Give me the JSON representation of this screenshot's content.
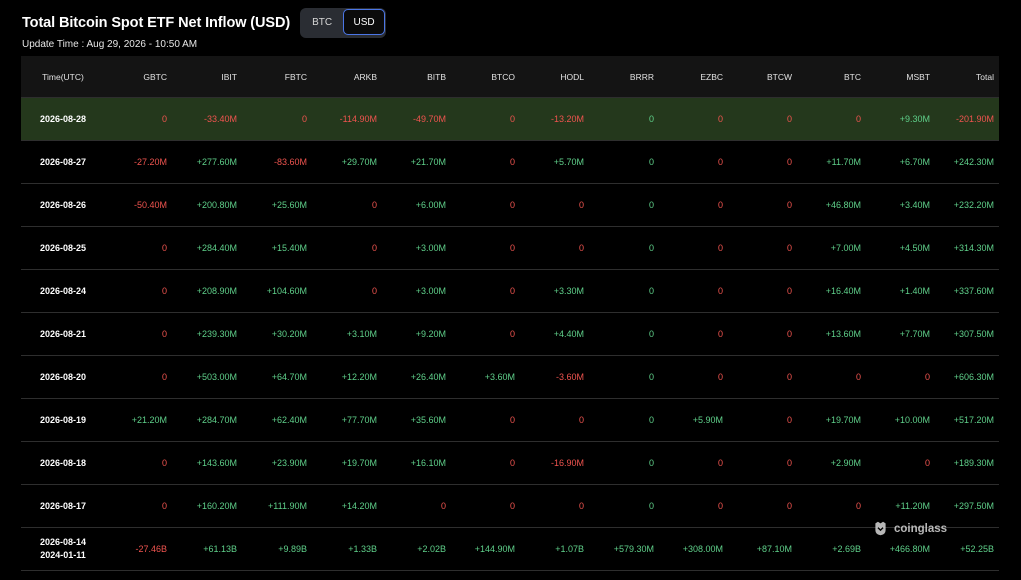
{
  "header": {
    "title": "Total Bitcoin Spot ETF Net Inflow (USD)",
    "toggle": {
      "options": [
        "BTC",
        "USD"
      ],
      "selected": "USD"
    },
    "update_time": "Update Time : Aug 29, 2026 - 10:50 AM"
  },
  "table": {
    "columns": [
      "Time(UTC)",
      "GBTC",
      "IBIT",
      "FBTC",
      "ARKB",
      "BITB",
      "BTCO",
      "HODL",
      "BRRR",
      "EZBC",
      "BTCW",
      "BTC",
      "MSBT",
      "Total"
    ],
    "rows": [
      {
        "time": [
          "2026-08-28"
        ],
        "highlight": true,
        "cells": [
          {
            "v": "0",
            "s": "neg"
          },
          {
            "v": "-33.40M",
            "s": "neg"
          },
          {
            "v": "0",
            "s": "neg"
          },
          {
            "v": "-114.90M",
            "s": "neg"
          },
          {
            "v": "-49.70M",
            "s": "neg"
          },
          {
            "v": "0",
            "s": "neg"
          },
          {
            "v": "-13.20M",
            "s": "neg"
          },
          {
            "v": "0",
            "s": "pos"
          },
          {
            "v": "0",
            "s": "neg"
          },
          {
            "v": "0",
            "s": "neg"
          },
          {
            "v": "0",
            "s": "neg"
          },
          {
            "v": "+9.30M",
            "s": "pos"
          },
          {
            "v": "-201.90M",
            "s": "neg"
          }
        ]
      },
      {
        "time": [
          "2026-08-27"
        ],
        "cells": [
          {
            "v": "-27.20M",
            "s": "neg"
          },
          {
            "v": "+277.60M",
            "s": "pos"
          },
          {
            "v": "-83.60M",
            "s": "neg"
          },
          {
            "v": "+29.70M",
            "s": "pos"
          },
          {
            "v": "+21.70M",
            "s": "pos"
          },
          {
            "v": "0",
            "s": "neg"
          },
          {
            "v": "+5.70M",
            "s": "pos"
          },
          {
            "v": "0",
            "s": "pos"
          },
          {
            "v": "0",
            "s": "neg"
          },
          {
            "v": "0",
            "s": "neg"
          },
          {
            "v": "+11.70M",
            "s": "pos"
          },
          {
            "v": "+6.70M",
            "s": "pos"
          },
          {
            "v": "+242.30M",
            "s": "pos"
          }
        ]
      },
      {
        "time": [
          "2026-08-26"
        ],
        "cells": [
          {
            "v": "-50.40M",
            "s": "neg"
          },
          {
            "v": "+200.80M",
            "s": "pos"
          },
          {
            "v": "+25.60M",
            "s": "pos"
          },
          {
            "v": "0",
            "s": "neg"
          },
          {
            "v": "+6.00M",
            "s": "pos"
          },
          {
            "v": "0",
            "s": "neg"
          },
          {
            "v": "0",
            "s": "neg"
          },
          {
            "v": "0",
            "s": "pos"
          },
          {
            "v": "0",
            "s": "neg"
          },
          {
            "v": "0",
            "s": "neg"
          },
          {
            "v": "+46.80M",
            "s": "pos"
          },
          {
            "v": "+3.40M",
            "s": "pos"
          },
          {
            "v": "+232.20M",
            "s": "pos"
          }
        ]
      },
      {
        "time": [
          "2026-08-25"
        ],
        "cells": [
          {
            "v": "0",
            "s": "neg"
          },
          {
            "v": "+284.40M",
            "s": "pos"
          },
          {
            "v": "+15.40M",
            "s": "pos"
          },
          {
            "v": "0",
            "s": "neg"
          },
          {
            "v": "+3.00M",
            "s": "pos"
          },
          {
            "v": "0",
            "s": "neg"
          },
          {
            "v": "0",
            "s": "neg"
          },
          {
            "v": "0",
            "s": "pos"
          },
          {
            "v": "0",
            "s": "neg"
          },
          {
            "v": "0",
            "s": "neg"
          },
          {
            "v": "+7.00M",
            "s": "pos"
          },
          {
            "v": "+4.50M",
            "s": "pos"
          },
          {
            "v": "+314.30M",
            "s": "pos"
          }
        ]
      },
      {
        "time": [
          "2026-08-24"
        ],
        "cells": [
          {
            "v": "0",
            "s": "neg"
          },
          {
            "v": "+208.90M",
            "s": "pos"
          },
          {
            "v": "+104.60M",
            "s": "pos"
          },
          {
            "v": "0",
            "s": "neg"
          },
          {
            "v": "+3.00M",
            "s": "pos"
          },
          {
            "v": "0",
            "s": "neg"
          },
          {
            "v": "+3.30M",
            "s": "pos"
          },
          {
            "v": "0",
            "s": "pos"
          },
          {
            "v": "0",
            "s": "neg"
          },
          {
            "v": "0",
            "s": "neg"
          },
          {
            "v": "+16.40M",
            "s": "pos"
          },
          {
            "v": "+1.40M",
            "s": "pos"
          },
          {
            "v": "+337.60M",
            "s": "pos"
          }
        ]
      },
      {
        "time": [
          "2026-08-21"
        ],
        "cells": [
          {
            "v": "0",
            "s": "neg"
          },
          {
            "v": "+239.30M",
            "s": "pos"
          },
          {
            "v": "+30.20M",
            "s": "pos"
          },
          {
            "v": "+3.10M",
            "s": "pos"
          },
          {
            "v": "+9.20M",
            "s": "pos"
          },
          {
            "v": "0",
            "s": "neg"
          },
          {
            "v": "+4.40M",
            "s": "pos"
          },
          {
            "v": "0",
            "s": "pos"
          },
          {
            "v": "0",
            "s": "neg"
          },
          {
            "v": "0",
            "s": "neg"
          },
          {
            "v": "+13.60M",
            "s": "pos"
          },
          {
            "v": "+7.70M",
            "s": "pos"
          },
          {
            "v": "+307.50M",
            "s": "pos"
          }
        ]
      },
      {
        "time": [
          "2026-08-20"
        ],
        "cells": [
          {
            "v": "0",
            "s": "neg"
          },
          {
            "v": "+503.00M",
            "s": "pos"
          },
          {
            "v": "+64.70M",
            "s": "pos"
          },
          {
            "v": "+12.20M",
            "s": "pos"
          },
          {
            "v": "+26.40M",
            "s": "pos"
          },
          {
            "v": "+3.60M",
            "s": "pos"
          },
          {
            "v": "-3.60M",
            "s": "neg"
          },
          {
            "v": "0",
            "s": "pos"
          },
          {
            "v": "0",
            "s": "neg"
          },
          {
            "v": "0",
            "s": "neg"
          },
          {
            "v": "0",
            "s": "neg"
          },
          {
            "v": "0",
            "s": "neg"
          },
          {
            "v": "+606.30M",
            "s": "pos"
          }
        ]
      },
      {
        "time": [
          "2026-08-19"
        ],
        "cells": [
          {
            "v": "+21.20M",
            "s": "pos"
          },
          {
            "v": "+284.70M",
            "s": "pos"
          },
          {
            "v": "+62.40M",
            "s": "pos"
          },
          {
            "v": "+77.70M",
            "s": "pos"
          },
          {
            "v": "+35.60M",
            "s": "pos"
          },
          {
            "v": "0",
            "s": "neg"
          },
          {
            "v": "0",
            "s": "neg"
          },
          {
            "v": "0",
            "s": "pos"
          },
          {
            "v": "+5.90M",
            "s": "pos"
          },
          {
            "v": "0",
            "s": "neg"
          },
          {
            "v": "+19.70M",
            "s": "pos"
          },
          {
            "v": "+10.00M",
            "s": "pos"
          },
          {
            "v": "+517.20M",
            "s": "pos"
          }
        ]
      },
      {
        "time": [
          "2026-08-18"
        ],
        "cells": [
          {
            "v": "0",
            "s": "neg"
          },
          {
            "v": "+143.60M",
            "s": "pos"
          },
          {
            "v": "+23.90M",
            "s": "pos"
          },
          {
            "v": "+19.70M",
            "s": "pos"
          },
          {
            "v": "+16.10M",
            "s": "pos"
          },
          {
            "v": "0",
            "s": "neg"
          },
          {
            "v": "-16.90M",
            "s": "neg"
          },
          {
            "v": "0",
            "s": "pos"
          },
          {
            "v": "0",
            "s": "neg"
          },
          {
            "v": "0",
            "s": "neg"
          },
          {
            "v": "+2.90M",
            "s": "pos"
          },
          {
            "v": "0",
            "s": "neg"
          },
          {
            "v": "+189.30M",
            "s": "pos"
          }
        ]
      },
      {
        "time": [
          "2026-08-17"
        ],
        "cells": [
          {
            "v": "0",
            "s": "neg"
          },
          {
            "v": "+160.20M",
            "s": "pos"
          },
          {
            "v": "+111.90M",
            "s": "pos"
          },
          {
            "v": "+14.20M",
            "s": "pos"
          },
          {
            "v": "0",
            "s": "neg"
          },
          {
            "v": "0",
            "s": "neg"
          },
          {
            "v": "0",
            "s": "neg"
          },
          {
            "v": "0",
            "s": "pos"
          },
          {
            "v": "0",
            "s": "neg"
          },
          {
            "v": "0",
            "s": "neg"
          },
          {
            "v": "0",
            "s": "neg"
          },
          {
            "v": "+11.20M",
            "s": "pos"
          },
          {
            "v": "+297.50M",
            "s": "pos"
          }
        ]
      },
      {
        "time": [
          "2026-08-14",
          "2024-01-11"
        ],
        "last": true,
        "cells": [
          {
            "v": "-27.46B",
            "s": "neg"
          },
          {
            "v": "+61.13B",
            "s": "pos"
          },
          {
            "v": "+9.89B",
            "s": "pos"
          },
          {
            "v": "+1.33B",
            "s": "pos"
          },
          {
            "v": "+2.02B",
            "s": "pos"
          },
          {
            "v": "+144.90M",
            "s": "pos"
          },
          {
            "v": "+1.07B",
            "s": "pos"
          },
          {
            "v": "+579.30M",
            "s": "pos"
          },
          {
            "v": "+308.00M",
            "s": "pos"
          },
          {
            "v": "+87.10M",
            "s": "pos"
          },
          {
            "v": "+2.69B",
            "s": "pos"
          },
          {
            "v": "+466.80M",
            "s": "pos"
          },
          {
            "v": "+52.25B",
            "s": "pos"
          }
        ]
      }
    ]
  },
  "watermark": {
    "text": "coinglass",
    "icon": "coinglass-logo-icon"
  },
  "colors": {
    "positive": "#5fd08a",
    "negative": "#f0544f",
    "highlight_row": "#24381c",
    "toggle_active_border": "#4b76e6"
  }
}
